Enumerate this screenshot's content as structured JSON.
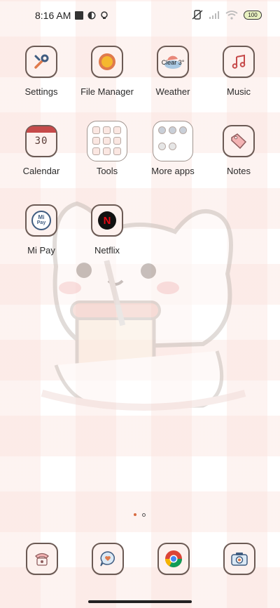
{
  "status": {
    "time": "8:16 AM",
    "battery": "100"
  },
  "apps": {
    "settings": "Settings",
    "file_manager": "File Manager",
    "weather": "Weather",
    "weather_badge": "Clear 3°",
    "music": "Music",
    "calendar": "Calendar",
    "calendar_day": "30",
    "tools": "Tools",
    "more_apps": "More apps",
    "notes": "Notes",
    "mi_pay": "Mi Pay",
    "mi_pay_badge_top": "Mi",
    "mi_pay_badge_bottom": "Pay",
    "netflix": "Netflix",
    "netflix_letter": "N"
  },
  "colors": {
    "accent": "#d76b41",
    "icon_border": "#6b5a54",
    "icon_bg": "#fdf1ee"
  },
  "pager": {
    "current": 1,
    "total": 2
  }
}
